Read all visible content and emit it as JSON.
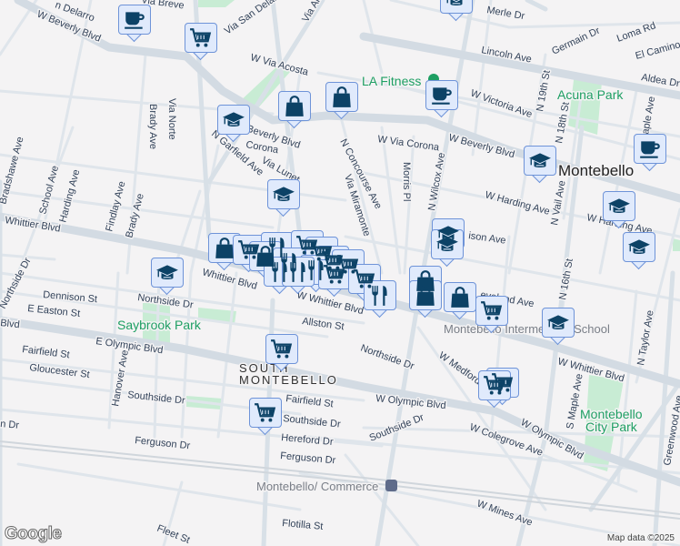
{
  "map": {
    "attribution": "Map data ©2025",
    "logo": "Google",
    "colors": {
      "marker_fill": "#e0eafc",
      "marker_border": "#6e93d8",
      "marker_icon": "#0c4266",
      "park": "#c8ecd4",
      "road": "#d3dbe3"
    }
  },
  "street_labels": [
    "W Beverly Blvd",
    "n Delarro",
    "Via Breve",
    "Via San Delano",
    "Via Alta",
    "W Via Acosta",
    "W Beverly Blvd",
    "Corona",
    "Via Lunet",
    "N Garfield Ave",
    "Via Norte",
    "Brady Ave",
    "Brady Ave",
    "Findlay Ave",
    "Harding Ave",
    "School Ave",
    "Bradshawe Ave",
    "Whittier Blvd",
    "Whittier Blvd",
    "W Whittier Blvd",
    "Northside Dr",
    "Dennison St",
    "E Easton St",
    "Northside Dr",
    "E Olympic Blvd",
    "Blvd",
    "Fairfield St",
    "Gloucester St",
    "Hanover Ave",
    "Southside Dr",
    "n Dr",
    "Ferguson Dr",
    "Allston St",
    "Fairfield St",
    "Southside Dr",
    "Hereford Dr",
    "Ferguson Dr",
    "Flotilla St",
    "Fleet St",
    "Merle Dr",
    "Loma Rd",
    "Germain Dr",
    "El Camino",
    "Lincoln Ave",
    "Aldea Dr",
    "W Victoria Ave",
    "N 19th St",
    "N 18th St",
    "aple Ave",
    "W Beverly Blvd",
    "W Via Corona",
    "N Concourse Ave",
    "Via Miramonte",
    "Morris Pl",
    "N Wilcox Ave",
    "W Harding Ave",
    "N Vail Ave",
    "W Harding Ave",
    "ison Ave",
    "eveland Ave",
    "N 16th St",
    "N Taylor Ave",
    "W Whittier Blvd",
    "S Maple Ave",
    "Greenwood Ave",
    "W Medford",
    "W Olympic Blvd",
    "W Olympic Blvd",
    "Northside Dr",
    "Southside Dr",
    "W Colegrove Ave",
    "W Mines Ave",
    "Hanover Ave"
  ],
  "place_labels": {
    "la_fitness": "LA Fitness",
    "acuna_park": "Acuna Park",
    "saybrook_park": "Saybrook Park",
    "city": "Montebello",
    "south_1": "SOUTH",
    "south_2": "MONTEBELLO",
    "school": "Montebello Intermediate School",
    "city_park_1": "Montebello",
    "city_park_2": "City Park",
    "station": "Montebello/ Commerce"
  },
  "markers": [
    {
      "type": "cafe"
    },
    {
      "type": "grocery"
    },
    {
      "type": "school"
    },
    {
      "type": "shopping"
    },
    {
      "type": "shopping"
    },
    {
      "type": "school"
    },
    {
      "type": "cafe"
    },
    {
      "type": "school"
    },
    {
      "type": "cafe"
    },
    {
      "type": "school"
    },
    {
      "type": "school"
    },
    {
      "type": "school"
    },
    {
      "type": "school"
    },
    {
      "type": "school"
    },
    {
      "type": "school"
    },
    {
      "type": "shopping"
    },
    {
      "type": "grocery"
    },
    {
      "type": "restaurant"
    },
    {
      "type": "grocery"
    },
    {
      "type": "grocery"
    },
    {
      "type": "shopping"
    },
    {
      "type": "restaurant"
    },
    {
      "type": "restaurant"
    },
    {
      "type": "grocery"
    },
    {
      "type": "restaurant"
    },
    {
      "type": "grocery"
    },
    {
      "type": "restaurant"
    },
    {
      "type": "grocery"
    },
    {
      "type": "grocery"
    },
    {
      "type": "restaurant"
    },
    {
      "type": "shopping"
    },
    {
      "type": "shopping"
    },
    {
      "type": "shopping"
    },
    {
      "type": "grocery"
    },
    {
      "type": "school"
    },
    {
      "type": "grocery"
    },
    {
      "type": "grocery"
    },
    {
      "type": "grocery"
    },
    {
      "type": "grocery"
    }
  ]
}
